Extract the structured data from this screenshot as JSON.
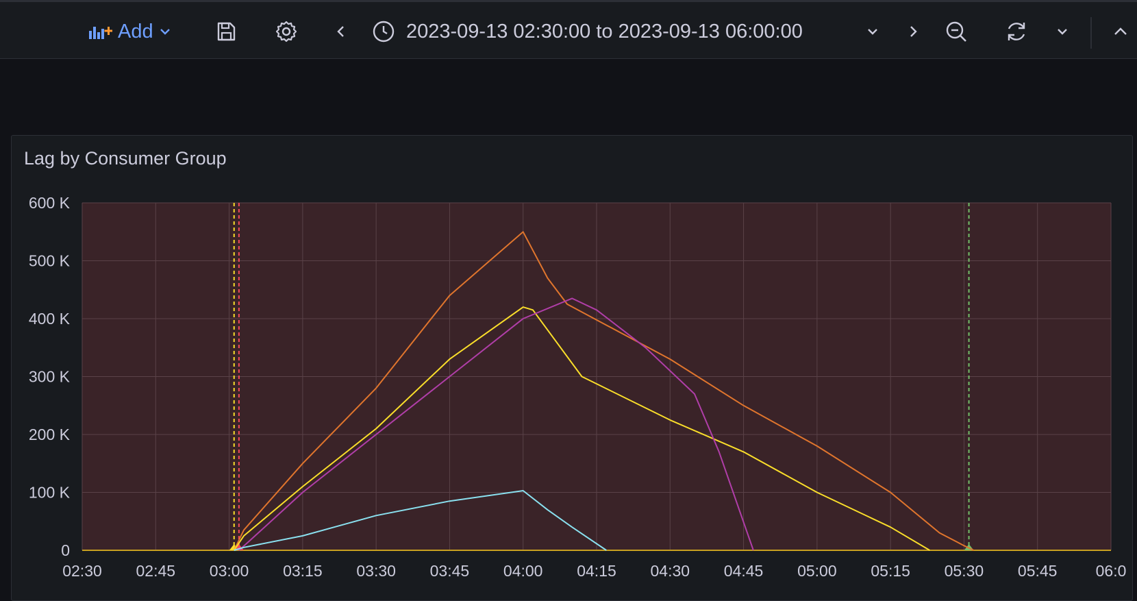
{
  "toolbar": {
    "add_label": "Add",
    "time_range": "2023-09-13 02:30:00 to 2023-09-13 06:00:00",
    "icons": [
      "add-panel-icon",
      "chevron-down-icon",
      "save-icon",
      "gear-icon",
      "chevron-left-icon",
      "clock-icon",
      "chevron-down-icon",
      "chevron-right-icon",
      "zoom-out-icon",
      "refresh-icon",
      "chevron-down-icon",
      "chevron-up-icon"
    ]
  },
  "panel": {
    "title": "Lag by Consumer Group"
  },
  "colors": {
    "background": "#111217",
    "panel": "#181b1f",
    "accent": "#6e9fff",
    "plot_bg": "#3a2328"
  },
  "chart_data": {
    "type": "line",
    "x_ticks": [
      "02:30",
      "02:45",
      "03:00",
      "03:15",
      "03:30",
      "03:45",
      "04:00",
      "04:15",
      "04:30",
      "04:45",
      "05:00",
      "05:15",
      "05:30",
      "05:45",
      "06:0"
    ],
    "xlim": [
      "02:30",
      "06:00"
    ],
    "y_ticks": [
      "0",
      "100 K",
      "200 K",
      "300 K",
      "400 K",
      "500 K",
      "600 K"
    ],
    "ylim": [
      0,
      600000
    ],
    "grid": true,
    "legend": "none",
    "series": [
      {
        "color": "#e0752d",
        "points": [
          [
            "03:01",
            0
          ],
          [
            "03:03",
            35000
          ],
          [
            "03:15",
            150000
          ],
          [
            "03:30",
            280000
          ],
          [
            "03:45",
            440000
          ],
          [
            "04:00",
            550000
          ],
          [
            "04:05",
            470000
          ],
          [
            "04:09",
            425000
          ],
          [
            "04:30",
            330000
          ],
          [
            "04:45",
            250000
          ],
          [
            "05:00",
            180000
          ],
          [
            "05:15",
            100000
          ],
          [
            "05:25",
            30000
          ],
          [
            "05:30",
            8000
          ],
          [
            "05:32",
            0
          ]
        ]
      },
      {
        "color": "#fade2a",
        "points": [
          [
            "03:01",
            0
          ],
          [
            "03:03",
            25000
          ],
          [
            "03:15",
            110000
          ],
          [
            "03:30",
            210000
          ],
          [
            "03:45",
            330000
          ],
          [
            "04:00",
            420000
          ],
          [
            "04:02",
            415000
          ],
          [
            "04:12",
            300000
          ],
          [
            "04:30",
            225000
          ],
          [
            "04:45",
            170000
          ],
          [
            "05:00",
            100000
          ],
          [
            "05:15",
            40000
          ],
          [
            "05:23",
            0
          ]
        ]
      },
      {
        "color": "#b03ea8",
        "points": [
          [
            "03:02",
            0
          ],
          [
            "03:04",
            15000
          ],
          [
            "03:15",
            100000
          ],
          [
            "03:30",
            200000
          ],
          [
            "03:45",
            300000
          ],
          [
            "04:00",
            400000
          ],
          [
            "04:10",
            435000
          ],
          [
            "04:15",
            415000
          ],
          [
            "04:25",
            350000
          ],
          [
            "04:35",
            270000
          ],
          [
            "04:40",
            170000
          ],
          [
            "04:47",
            0
          ]
        ]
      },
      {
        "color": "#8ae1f0",
        "points": [
          [
            "03:01",
            0
          ],
          [
            "03:03",
            5000
          ],
          [
            "03:15",
            25000
          ],
          [
            "03:30",
            60000
          ],
          [
            "03:45",
            85000
          ],
          [
            "04:00",
            103000
          ],
          [
            "04:05",
            70000
          ],
          [
            "04:10",
            40000
          ],
          [
            "04:17",
            0
          ]
        ]
      }
    ],
    "annotations": [
      {
        "time": "03:01",
        "color": "#fade2a",
        "style": "dashed"
      },
      {
        "time": "03:02",
        "color": "#f2495c",
        "style": "dashed"
      },
      {
        "time": "05:31",
        "color": "#73bf69",
        "style": "dashed"
      }
    ]
  }
}
